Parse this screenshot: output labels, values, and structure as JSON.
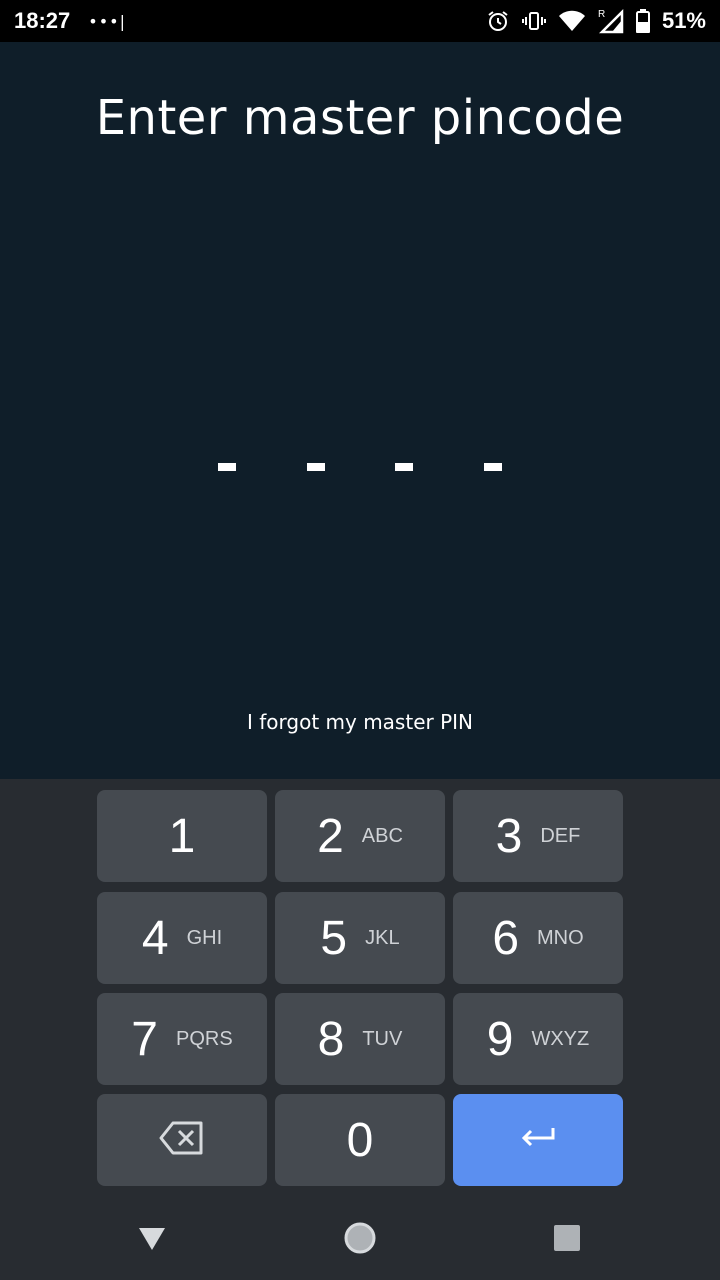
{
  "status_bar": {
    "time": "18:27",
    "notif_dots": "•••|",
    "battery": "51%",
    "icons": [
      "alarm-icon",
      "vibrate-icon",
      "wifi-icon",
      "signal-icon",
      "battery-icon"
    ]
  },
  "screen": {
    "title": "Enter master pincode",
    "pin_placeholder_count": 4,
    "forgot_link": "I forgot my master PIN"
  },
  "keypad": {
    "keys": [
      {
        "digit": "1",
        "letters": ""
      },
      {
        "digit": "2",
        "letters": "ABC"
      },
      {
        "digit": "3",
        "letters": "DEF"
      },
      {
        "digit": "4",
        "letters": "GHI"
      },
      {
        "digit": "5",
        "letters": "JKL"
      },
      {
        "digit": "6",
        "letters": "MNO"
      },
      {
        "digit": "7",
        "letters": "PQRS"
      },
      {
        "digit": "8",
        "letters": "TUV"
      },
      {
        "digit": "9",
        "letters": "WXYZ"
      },
      {
        "digit": "0",
        "letters": ""
      }
    ],
    "backspace_icon": "backspace-icon",
    "enter_icon": "enter-arrow-icon",
    "enter_color": "#5b8ff0"
  },
  "navbar": {
    "icons": [
      "back-triangle-icon",
      "home-circle-icon",
      "recents-square-icon"
    ]
  },
  "colors": {
    "background": "#0f1e29",
    "keypad_bg": "#282c31",
    "key_bg": "#454a50"
  }
}
